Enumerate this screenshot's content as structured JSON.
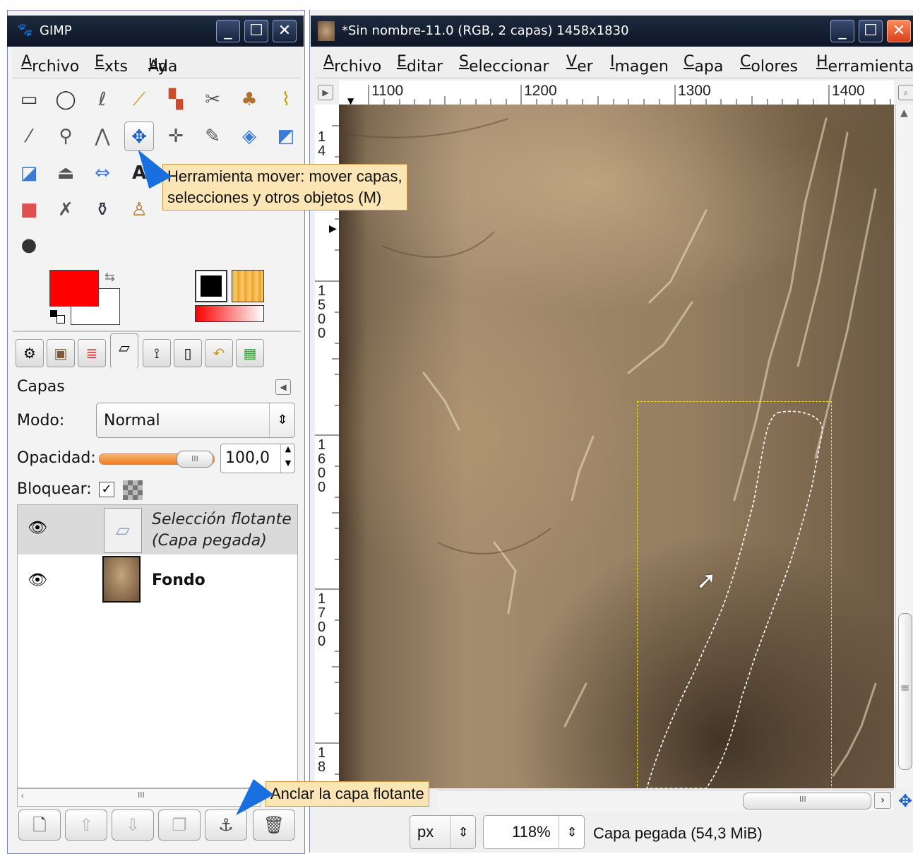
{
  "toolbox": {
    "title": "GIMP",
    "menu": [
      {
        "pre": "",
        "ul": "A",
        "post": "rchivo"
      },
      {
        "pre": "",
        "ul": "E",
        "post": "xts"
      },
      {
        "pre": "Ay",
        "ul": "u",
        "post": "da"
      }
    ],
    "tooltip_move_line1": "Herramienta mover: mover capas,",
    "tooltip_move_line2": "selecciones y otros objetos  (M)",
    "colors": {
      "foreground": "#ff0000",
      "background": "#ffffff"
    }
  },
  "layers_dock": {
    "title": "Capas",
    "mode_label": "Modo:",
    "mode_value": "Normal",
    "opacity_label": "Opacidad:",
    "opacity_value": "100,0",
    "lock_label": "Bloquear:",
    "layers": [
      {
        "name_line1": "Selección flotante",
        "name_line2": "(Capa pegada)"
      },
      {
        "name_line1": "Fondo"
      }
    ],
    "scroll_glyph": "III",
    "tooltip_anchor": "Anclar la capa flotante"
  },
  "image_window": {
    "title": "*Sin nombre-11.0 (RGB, 2 capas) 1458x1830",
    "menu": [
      {
        "ul": "A",
        "post": "rchivo"
      },
      {
        "ul": "E",
        "post": "ditar"
      },
      {
        "ul": "S",
        "post": "eleccionar"
      },
      {
        "ul": "V",
        "post": "er"
      },
      {
        "ul": "I",
        "post": "magen"
      },
      {
        "ul": "C",
        "post": "apa"
      },
      {
        "ul": "C",
        "post": "olores"
      },
      {
        "ul": "H",
        "post": "erramientas"
      }
    ],
    "hruler": [
      "1100",
      "1200",
      "1300",
      "1400"
    ],
    "vruler": [
      "14",
      "1500",
      "1600",
      "1700",
      "18"
    ],
    "hscroll_glyph": "III",
    "vscroll_glyph": "≡",
    "status_unit": "px",
    "status_zoom": "118%",
    "status_text": "Capa pegada (54,3 MiB)"
  }
}
